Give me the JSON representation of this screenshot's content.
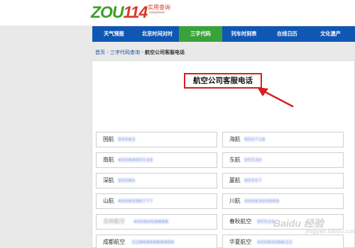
{
  "logo": {
    "zou": "ZOU",
    "num": "114",
    "sub": "实用查询"
  },
  "nav": [
    {
      "label": "天气预报"
    },
    {
      "label": "北京时间对时"
    },
    {
      "label": "三字代码",
      "active": true
    },
    {
      "label": "列车时刻表"
    },
    {
      "label": "在线日历"
    },
    {
      "label": "文化遗产"
    }
  ],
  "breadcrumb": {
    "home": "首页",
    "sep1": " - ",
    "section": "三字代码查询",
    "sep2": " - ",
    "current": "航空公司客服电话"
  },
  "title": "航空公司客服电话",
  "airlines": [
    {
      "name": "国航",
      "phone": "95583"
    },
    {
      "name": "海航",
      "phone": "950718"
    },
    {
      "name": "南航",
      "phone": "4006695539"
    },
    {
      "name": "东航",
      "phone": "95530"
    },
    {
      "name": "深航",
      "phone": "95080"
    },
    {
      "name": "厦航",
      "phone": "95557"
    },
    {
      "name": "山航",
      "phone": "4006096777"
    },
    {
      "name": "川航",
      "phone": "4008300999"
    },
    {
      "name": "吉祥航空",
      "phone": "4006008888"
    },
    {
      "name": "春秋航空",
      "phone": "95524"
    },
    {
      "name": "成都航空",
      "phone": "028666888888"
    },
    {
      "name": "华夏航空",
      "phone": "4006006633"
    }
  ],
  "watermark": {
    "main": "Baidu 经验",
    "sub": "jingyan.baidu.com"
  },
  "colors": {
    "nav_bg": "#0f57b3",
    "nav_active": "#39a23a",
    "title_border": "#d52121",
    "phone_blue": "#4a6bd8"
  }
}
